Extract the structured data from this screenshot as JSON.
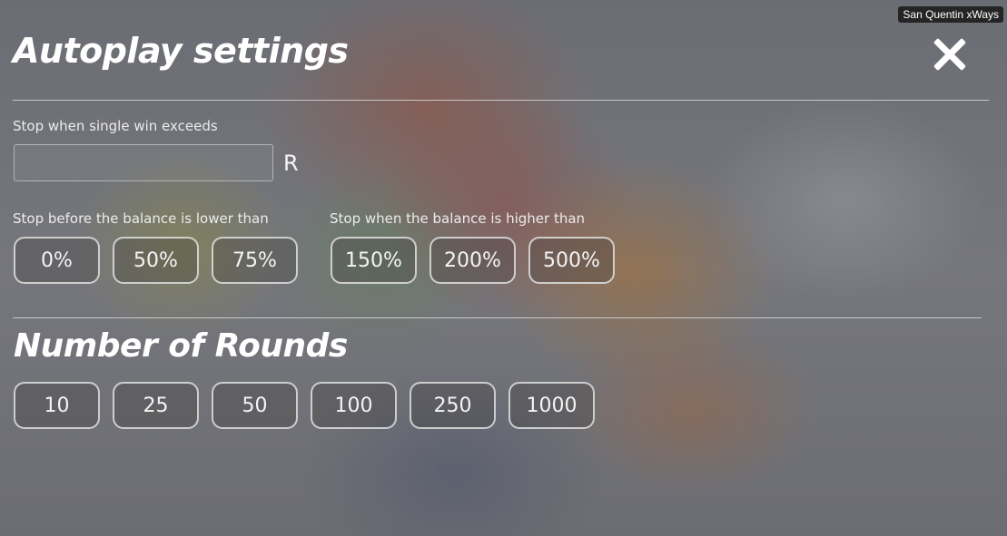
{
  "badge": "San Quentin xWays",
  "dialog": {
    "title": "Autoplay settings"
  },
  "single_win": {
    "label": "Stop when single win exceeds",
    "value": "",
    "placeholder": "",
    "currency": "R"
  },
  "balance_lower": {
    "label": "Stop before the balance is lower than",
    "options": [
      "0%",
      "50%",
      "75%"
    ]
  },
  "balance_higher": {
    "label": "Stop when the balance is higher than",
    "options": [
      "150%",
      "200%",
      "500%"
    ]
  },
  "rounds": {
    "title": "Number of Rounds",
    "options": [
      "10",
      "25",
      "50",
      "100",
      "250",
      "1000"
    ]
  },
  "icons": {
    "close": "close-icon"
  }
}
